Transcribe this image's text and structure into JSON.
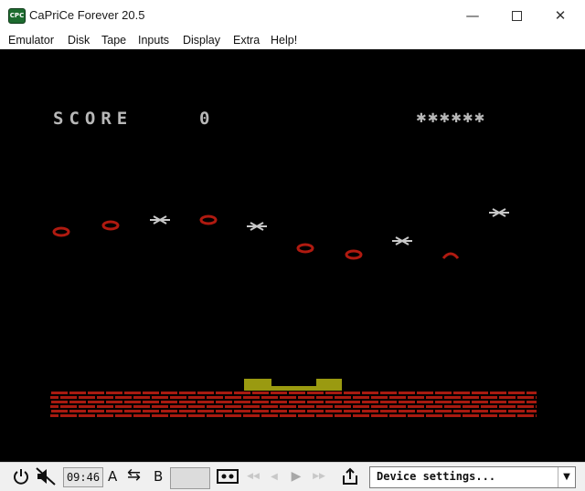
{
  "window": {
    "title": "CaPriCe Forever 20.5",
    "app_icon_text": "CPC",
    "minimize_glyph": "—",
    "close_glyph": "✕"
  },
  "menu": {
    "items": [
      "Emulator",
      "Disk",
      "Tape",
      "Inputs",
      "Display",
      "Extra",
      "Help!"
    ]
  },
  "game": {
    "score_label": "SCORE",
    "score_value": "0",
    "lives_marks": "✱✱✱✱✱✱",
    "colors": {
      "background": "#000000",
      "text": "#b8b8b8",
      "enemy_red": "#b01a10",
      "enemy_white": "#c8c8c8",
      "brick": "#a81a10",
      "cannon": "#9a9a10"
    },
    "enemy_shapes": [
      "ring",
      "ring",
      "star",
      "ring",
      "star",
      "ring",
      "ring",
      "star",
      "arc",
      "star"
    ]
  },
  "status": {
    "power_icon": "power-icon",
    "mute_icon": "speaker-muted-icon",
    "clock": "09:46",
    "drive_a": "A",
    "swap_glyph": "⇆",
    "drive_b": "B",
    "tape_glyph": "▣",
    "rewind_glyph": "◀◀",
    "prev_glyph": "◀",
    "play_glyph": "▶",
    "ff_glyph": "▶▶",
    "export_glyph": "⇪",
    "device_label": "Device settings...",
    "dropdown_glyph": "▼"
  }
}
